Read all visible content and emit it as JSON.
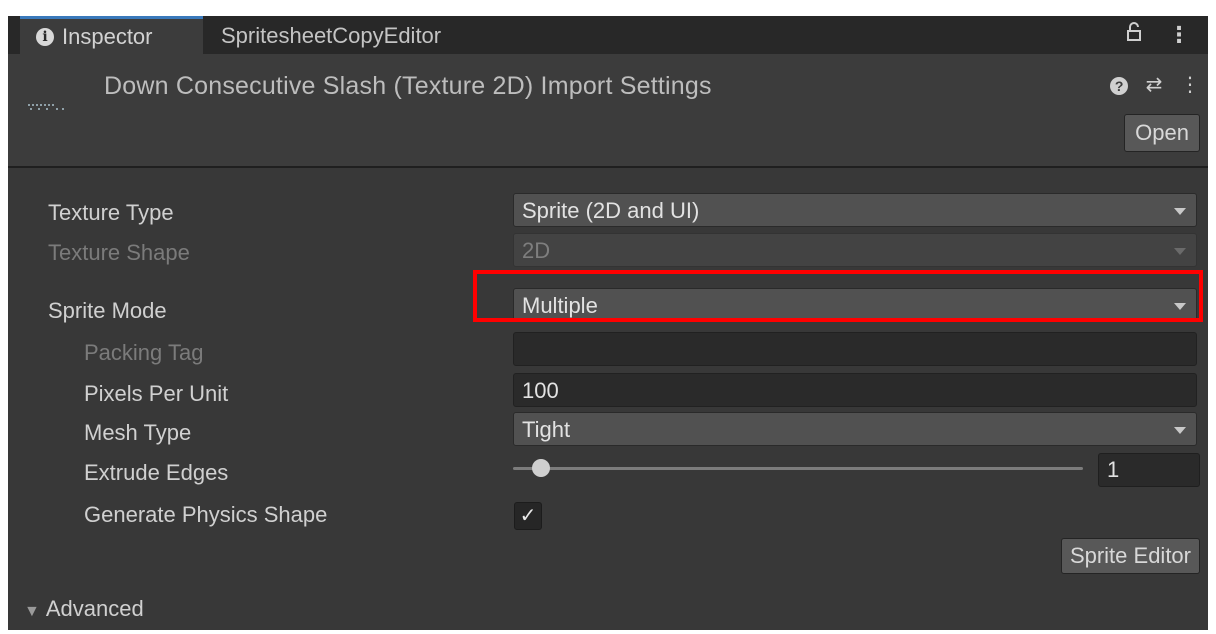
{
  "tabs": [
    {
      "label": "Inspector",
      "active": true,
      "icon": "info-icon"
    },
    {
      "label": "SpritesheetCopyEditor",
      "active": false
    }
  ],
  "tab_tools": {
    "lock_glyph": "ä¸",
    "menu_glyph": "⋮"
  },
  "header": {
    "title": "Down Consecutive Slash (Texture 2D) Import Settings",
    "open_label": "Open",
    "help_glyph": "?",
    "presets_glyph": "⇄",
    "menu_glyph": "⋮"
  },
  "settings": {
    "texture_type": {
      "label": "Texture Type",
      "value": "Sprite (2D and UI)"
    },
    "texture_shape": {
      "label": "Texture Shape",
      "value": "2D"
    },
    "sprite_mode": {
      "label": "Sprite Mode",
      "value": "Multiple"
    },
    "packing_tag": {
      "label": "Packing Tag",
      "value": ""
    },
    "pixels_per_unit": {
      "label": "Pixels Per Unit",
      "value": "100"
    },
    "mesh_type": {
      "label": "Mesh Type",
      "value": "Tight"
    },
    "extrude_edges": {
      "label": "Extrude Edges",
      "value": "1"
    },
    "generate_physics_shape": {
      "label": "Generate Physics Shape",
      "checked": true,
      "check_glyph": "✓"
    }
  },
  "sprite_editor_label": "Sprite Editor",
  "advanced": {
    "label": "Advanced",
    "glyph": "▼"
  },
  "colors": {
    "highlight": "#ff0000",
    "active_tab_accent": "#3a79bb"
  }
}
